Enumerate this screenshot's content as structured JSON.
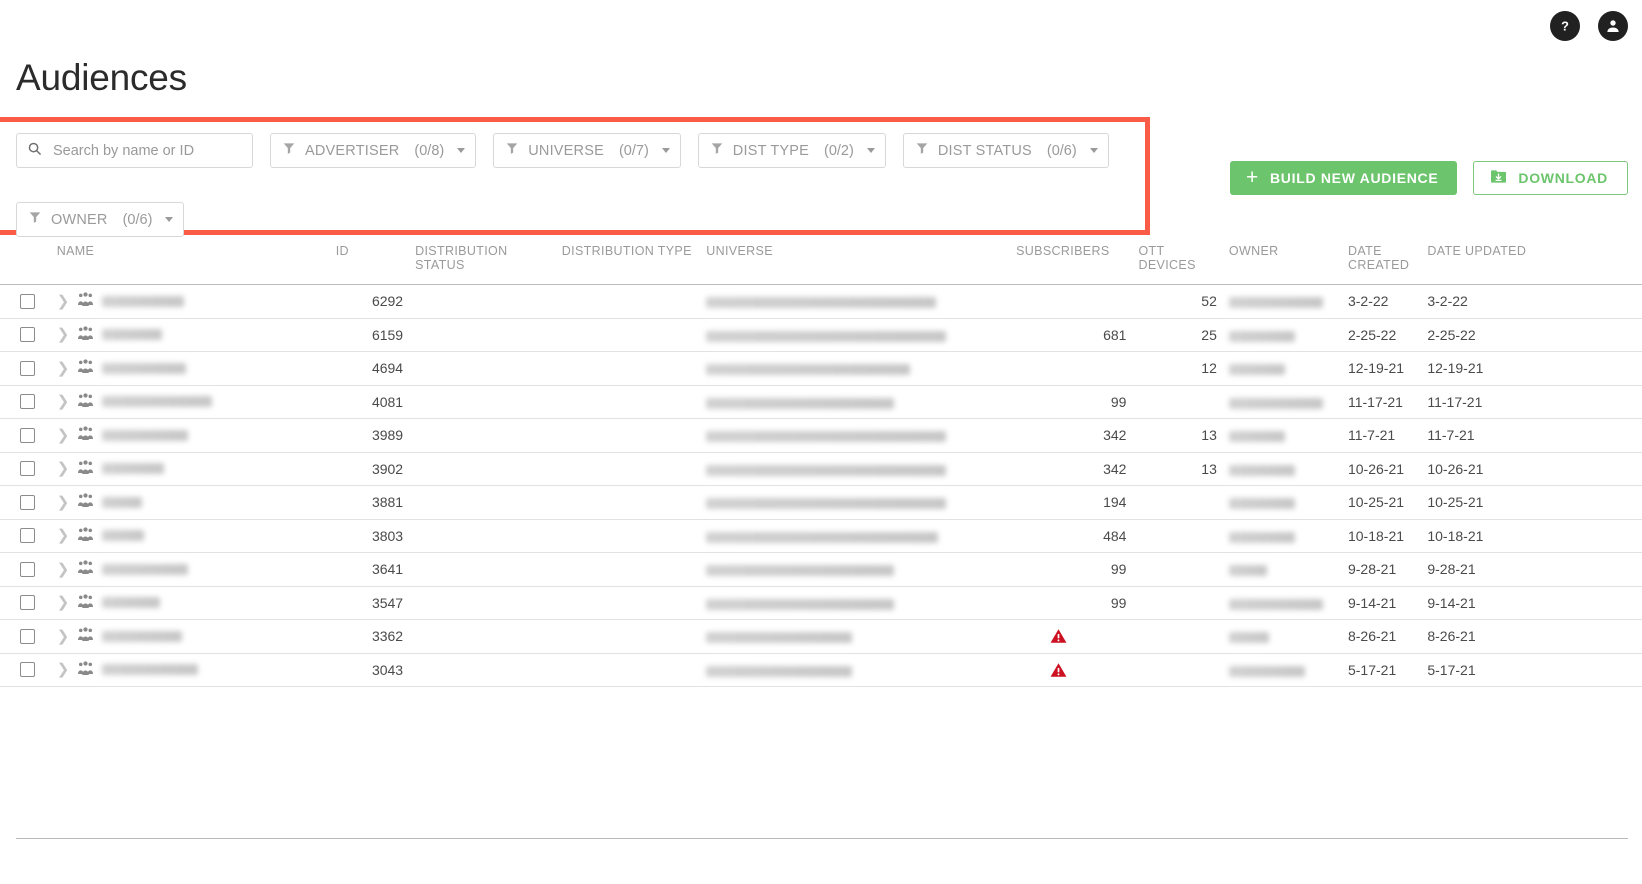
{
  "header": {
    "help_icon": "help-circle-icon",
    "account_icon": "account-circle-icon"
  },
  "page_title": "Audiences",
  "accent_colors": {
    "highlight": "#fa5c47",
    "primary_green": "#6cc46c",
    "warning_red": "#cc1122"
  },
  "search": {
    "placeholder": "Search by name or ID",
    "value": "",
    "icon": "search-icon"
  },
  "filters": [
    {
      "label": "ADVERTISER",
      "count": "(0/8)",
      "icon": "filter-icon"
    },
    {
      "label": "UNIVERSE",
      "count": "(0/7)",
      "icon": "filter-icon"
    },
    {
      "label": "DIST TYPE",
      "count": "(0/2)",
      "icon": "filter-icon"
    },
    {
      "label": "DIST STATUS",
      "count": "(0/6)",
      "icon": "filter-icon"
    },
    {
      "label": "OWNER",
      "count": "(0/6)",
      "icon": "filter-icon"
    }
  ],
  "actions": {
    "build_label": "BUILD NEW AUDIENCE",
    "build_icon": "plus-icon",
    "download_label": "DOWNLOAD",
    "download_icon": "folder-download-icon"
  },
  "table": {
    "columns": [
      {
        "key": "select",
        "label": ""
      },
      {
        "key": "name",
        "label": "NAME"
      },
      {
        "key": "id",
        "label": "ID"
      },
      {
        "key": "dstatus",
        "label": "DISTRIBUTION STATUS"
      },
      {
        "key": "dtype",
        "label": "DISTRIBUTION TYPE"
      },
      {
        "key": "universe",
        "label": "UNIVERSE"
      },
      {
        "key": "subs",
        "label": "SUBSCRIBERS"
      },
      {
        "key": "ott",
        "label": "OTT DEVICES"
      },
      {
        "key": "owner",
        "label": "OWNER"
      },
      {
        "key": "created",
        "label": "DATE CREATED"
      },
      {
        "key": "updated",
        "label": "DATE UPDATED"
      }
    ],
    "rows": [
      {
        "id": "6292",
        "dtype": "",
        "subs": "",
        "ott": "52",
        "created": "3-2-22",
        "updated": "3-2-22",
        "warning": false,
        "name_w": 82,
        "universe_w": 230,
        "owner_w": 94
      },
      {
        "id": "6159",
        "dtype": "",
        "subs": "681",
        "ott": "25",
        "created": "2-25-22",
        "updated": "2-25-22",
        "warning": false,
        "name_w": 60,
        "universe_w": 240,
        "owner_w": 66
      },
      {
        "id": "4694",
        "dtype": "",
        "subs": "",
        "ott": "12",
        "created": "12-19-21",
        "updated": "12-19-21",
        "warning": false,
        "name_w": 84,
        "universe_w": 204,
        "owner_w": 56
      },
      {
        "id": "4081",
        "dtype": "",
        "subs": "99",
        "ott": "",
        "created": "11-17-21",
        "updated": "11-17-21",
        "warning": false,
        "name_w": 110,
        "universe_w": 188,
        "owner_w": 94
      },
      {
        "id": "3989",
        "dtype": "",
        "subs": "342",
        "ott": "13",
        "created": "11-7-21",
        "updated": "11-7-21",
        "warning": false,
        "name_w": 86,
        "universe_w": 240,
        "owner_w": 56
      },
      {
        "id": "3902",
        "dtype": "",
        "subs": "342",
        "ott": "13",
        "created": "10-26-21",
        "updated": "10-26-21",
        "warning": false,
        "name_w": 62,
        "universe_w": 240,
        "owner_w": 66
      },
      {
        "id": "3881",
        "dtype": "",
        "subs": "194",
        "ott": "",
        "created": "10-25-21",
        "updated": "10-25-21",
        "warning": false,
        "name_w": 40,
        "universe_w": 240,
        "owner_w": 66
      },
      {
        "id": "3803",
        "dtype": "",
        "subs": "484",
        "ott": "",
        "created": "10-18-21",
        "updated": "10-18-21",
        "warning": false,
        "name_w": 42,
        "universe_w": 232,
        "owner_w": 66
      },
      {
        "id": "3641",
        "dtype": "",
        "subs": "99",
        "ott": "",
        "created": "9-28-21",
        "updated": "9-28-21",
        "warning": false,
        "name_w": 86,
        "universe_w": 188,
        "owner_w": 38
      },
      {
        "id": "3547",
        "dtype": "",
        "subs": "99",
        "ott": "",
        "created": "9-14-21",
        "updated": "9-14-21",
        "warning": false,
        "name_w": 58,
        "universe_w": 188,
        "owner_w": 94
      },
      {
        "id": "3362",
        "dtype": "",
        "subs": "",
        "ott": "",
        "created": "8-26-21",
        "updated": "8-26-21",
        "warning": true,
        "name_w": 80,
        "universe_w": 146,
        "owner_w": 40
      },
      {
        "id": "3043",
        "dtype": "",
        "subs": "",
        "ott": "",
        "created": "5-17-21",
        "updated": "5-17-21",
        "warning": true,
        "name_w": 96,
        "universe_w": 146,
        "owner_w": 76
      }
    ]
  }
}
